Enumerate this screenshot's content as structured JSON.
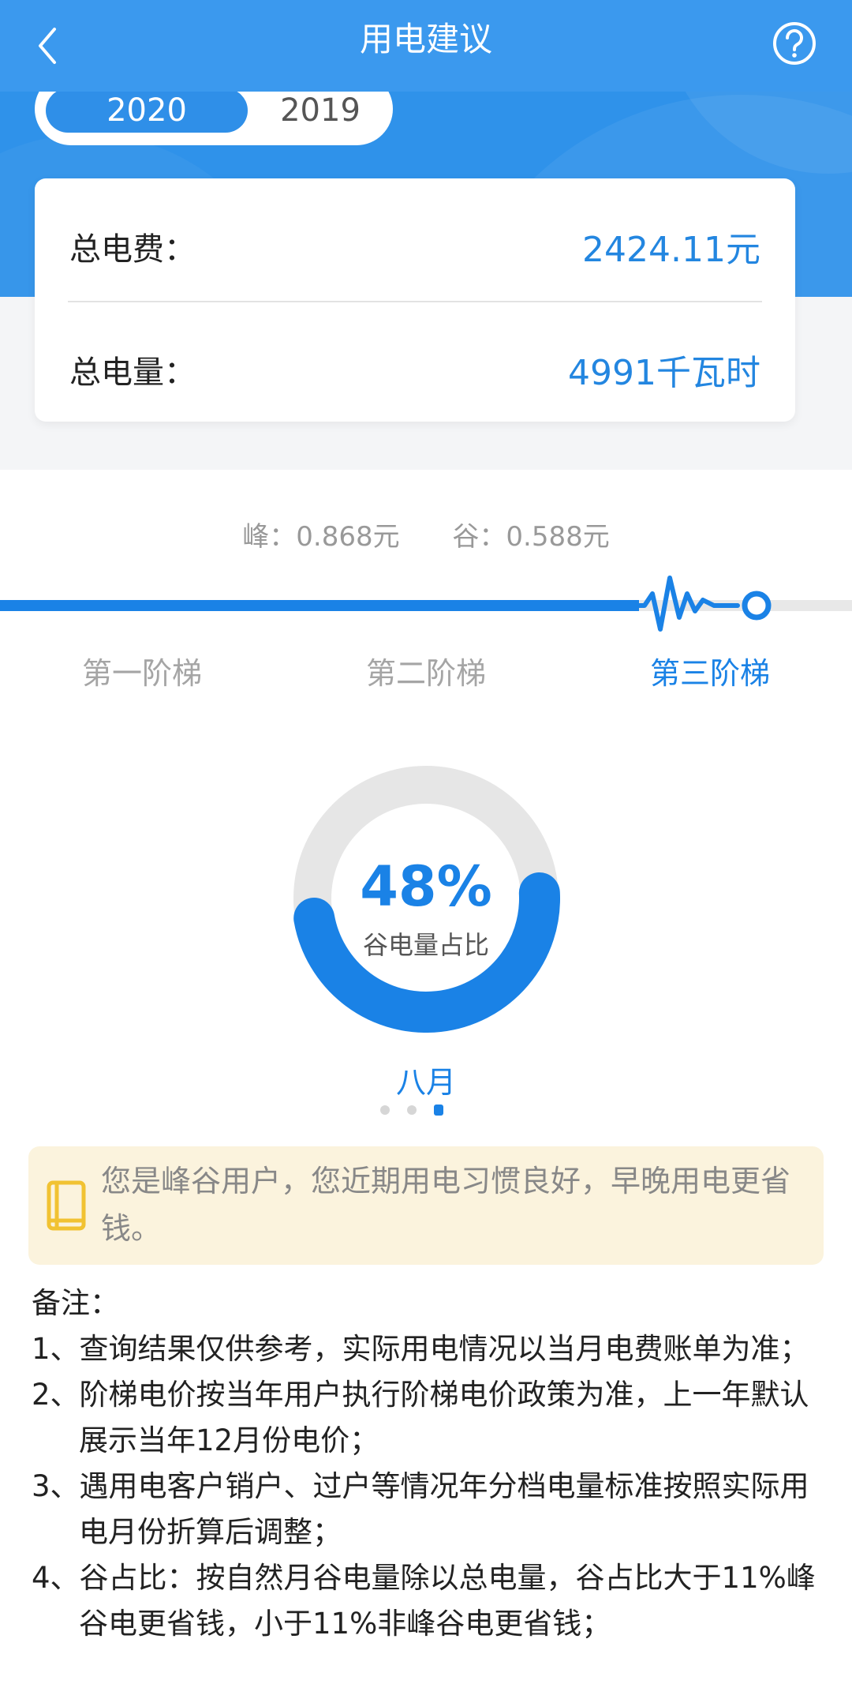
{
  "header": {
    "title": "用电建议"
  },
  "years": {
    "selected": "2020",
    "other": "2019"
  },
  "summary": {
    "total_fee_label": "总电费：",
    "total_fee_value": "2424.11元",
    "total_usage_label": "总电量：",
    "total_usage_value": "4991千瓦时"
  },
  "prices": {
    "peak": "峰：0.868元",
    "valley": "谷：0.588元"
  },
  "tiers": {
    "t1": "第一阶梯",
    "t2": "第二阶梯",
    "t3": "第三阶梯",
    "active": 3
  },
  "valley_ratio": {
    "percent_text": "48%",
    "percent": 48,
    "label": "谷电量占比"
  },
  "month": {
    "label": "八月"
  },
  "pager": {
    "total": 3,
    "current": 3
  },
  "tip": {
    "text": "您是峰谷用户，您近期用电习惯良好，早晚用电更省钱。"
  },
  "notes": {
    "title": "备注：",
    "items": [
      "1、查询结果仅供参考，实际用电情况以当月电费账单为准；",
      "2、阶梯电价按当年用户执行阶梯电价政策为准，上一年默认展示当年12月份电价；",
      "3、遇用电客户销户、过户等情况年分档电量标准按照实际用电月份折算后调整；",
      "4、谷占比：按自然月谷电量除以总电量，谷占比大于11%峰谷电更省钱，小于11%非峰谷电更省钱；"
    ]
  },
  "colors": {
    "primary": "#1a82e6",
    "header": "#2f92ea",
    "tip_bg": "#fbf3dd",
    "tip_icon": "#f1c232"
  }
}
